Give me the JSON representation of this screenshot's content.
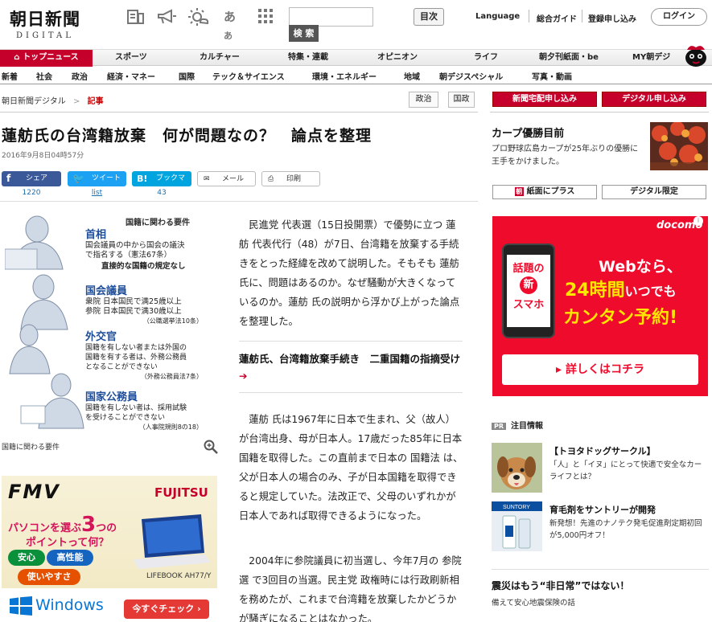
{
  "header": {
    "logo_main": "朝日新聞",
    "logo_sub": "DIGITAL",
    "icons": [
      "newspaper-icon",
      "megaphone-icon",
      "weather-icon",
      "font-size-icon",
      "grid-menu-icon"
    ],
    "search_placeholder": "",
    "search_button": "検 索",
    "toc_button": "目次",
    "links": [
      "Language",
      "総合ガイド",
      "登録申し込み"
    ],
    "login_button": "ログイン"
  },
  "nav1": [
    "トップニュース",
    "スポーツ",
    "カルチャー",
    "特集・連載",
    "オピニオン",
    "ライフ",
    "朝夕刊紙面・be",
    "MY朝デジ"
  ],
  "nav2": [
    "新着",
    "社会",
    "政治",
    "経済・マネー",
    "国際",
    "テック＆サイエンス",
    "環境・エネルギー",
    "地域",
    "朝デジスペシャル",
    "写真・動画"
  ],
  "breadcrumb": {
    "root": "朝日新聞デジタル",
    "sep": ">",
    "current": "記事"
  },
  "tags": [
    "政治",
    "国政"
  ],
  "article": {
    "title": "蓮舫氏の台湾籍放棄　何が問題なの？　論点を整理",
    "date": "2016年9月8日04時57分",
    "share": [
      {
        "label": "シェア",
        "count": "1220"
      },
      {
        "label": "ツイート",
        "count": "list"
      },
      {
        "label": "ブックマーク",
        "count": "43"
      },
      {
        "label": "メール",
        "count": ""
      },
      {
        "label": "印刷",
        "count": ""
      }
    ],
    "infographic": {
      "heading": "国籍に関わる要件",
      "caption": "国籍に関わる要件",
      "items": [
        {
          "title": "首相",
          "lines": [
            "国会議員の中から国会の議決",
            "で指名する（憲法67条）",
            "直接的な国籍の規定なし"
          ]
        },
        {
          "title": "国会議員",
          "lines": [
            "衆院 日本国民で満25歳以上",
            "参院 日本国民で満30歳以上",
            "（公職選挙法10条）"
          ]
        },
        {
          "title": "外交官",
          "lines": [
            "国籍を有しない者または外国の",
            "国籍を有する者は、外務公務員",
            "となることができない",
            "（外務公務員法7条）"
          ]
        },
        {
          "title": "国家公務員",
          "lines": [
            "国籍を有しない者は、採用試験",
            "を受けることができない",
            "（人事院規則8の18）"
          ]
        }
      ]
    },
    "paragraphs": [
      "民進党 代表選（15日投開票）で優勢に立つ 蓮舫 代表代行（48）が7日、台湾籍を放棄する手続きをとった経緯を改めて説明した。そもそも 蓮舫 氏に、問題はあるのか。なぜ騒動が大きくなっているのか。蓮舫 氏の説明から浮かび上がった論点を整理した。",
      "蓮舫 氏は1967年に日本で生まれ、父（故人）が台湾出身、母が日本人。17歳だった85年に日本国籍を取得した。この直前まで日本の 国籍法 は、父が日本人の場合のみ、子が日本国籍を取得できると規定していた。法改正で、父母のいずれかが日本人であれば取得できるようになった。",
      "2004年に参院議員に初当選し、今年7月の 参院選 で3回目の当選。民主党 政権時には行政刷新相を務めたが、これまで台湾籍を放棄したかどうかが騒ぎになることはなかった。"
    ],
    "related_link": "蓮舫氏、台湾籍放棄手続き　二重国籍の指摘受け",
    "related_arrow": "➔"
  },
  "fmv_ad": {
    "brand": "FMV",
    "maker": "FUJITSU",
    "line1": "パソコンを選ぶ",
    "number": "3",
    "line2": "つの",
    "line3": "ポイントって何？",
    "pills": [
      "安心",
      "高性能",
      "使いやすさ"
    ],
    "model": "LIFEBOOK AH77/Y",
    "os": "Windows",
    "cta": "今すぐチェック ›"
  },
  "right": {
    "buttons": [
      "新聞宅配申し込み",
      "デジタル申し込み"
    ],
    "feature_title": "カープ優勝目前",
    "feature_desc": "プロ野球広島カープが25年ぶりの優勝に王手をかけました。",
    "wide_buttons": [
      "紙面にプラス",
      "デジタル限定"
    ],
    "docomo_ad": {
      "brand": "docomo",
      "phone_lines": [
        "話題の",
        "新",
        "スマホ"
      ],
      "headline1": "Webなら、",
      "headline2": "24時間",
      "headline2b": "いつでも",
      "headline3": "カンタン予約!",
      "cta": "▸ 詳しくはコチラ"
    },
    "pr_badge": "PR",
    "pr_heading": "注目情報",
    "pr_items": [
      {
        "title": "【トヨタドッグサークル】",
        "desc": "「人」と「イヌ」にとって快適で安全なカーライフとは？",
        "img": "dog-photo"
      },
      {
        "title": "育毛剤をサントリーが開発",
        "desc": "新発想！先進のナノテク発毛促進剤定期初回が5,000円オフ！",
        "img": "suntory-bottle"
      }
    ],
    "bottom_title": "震災はもう“非日常”ではない！",
    "bottom_desc": "備えて安心地震保険の話"
  },
  "colors": {
    "brand_red": "#c5002b",
    "fb_blue": "#3b5998",
    "tw_blue": "#1da1f2",
    "hatena_blue": "#00a4de",
    "docomo_red": "#ef0b2c"
  }
}
